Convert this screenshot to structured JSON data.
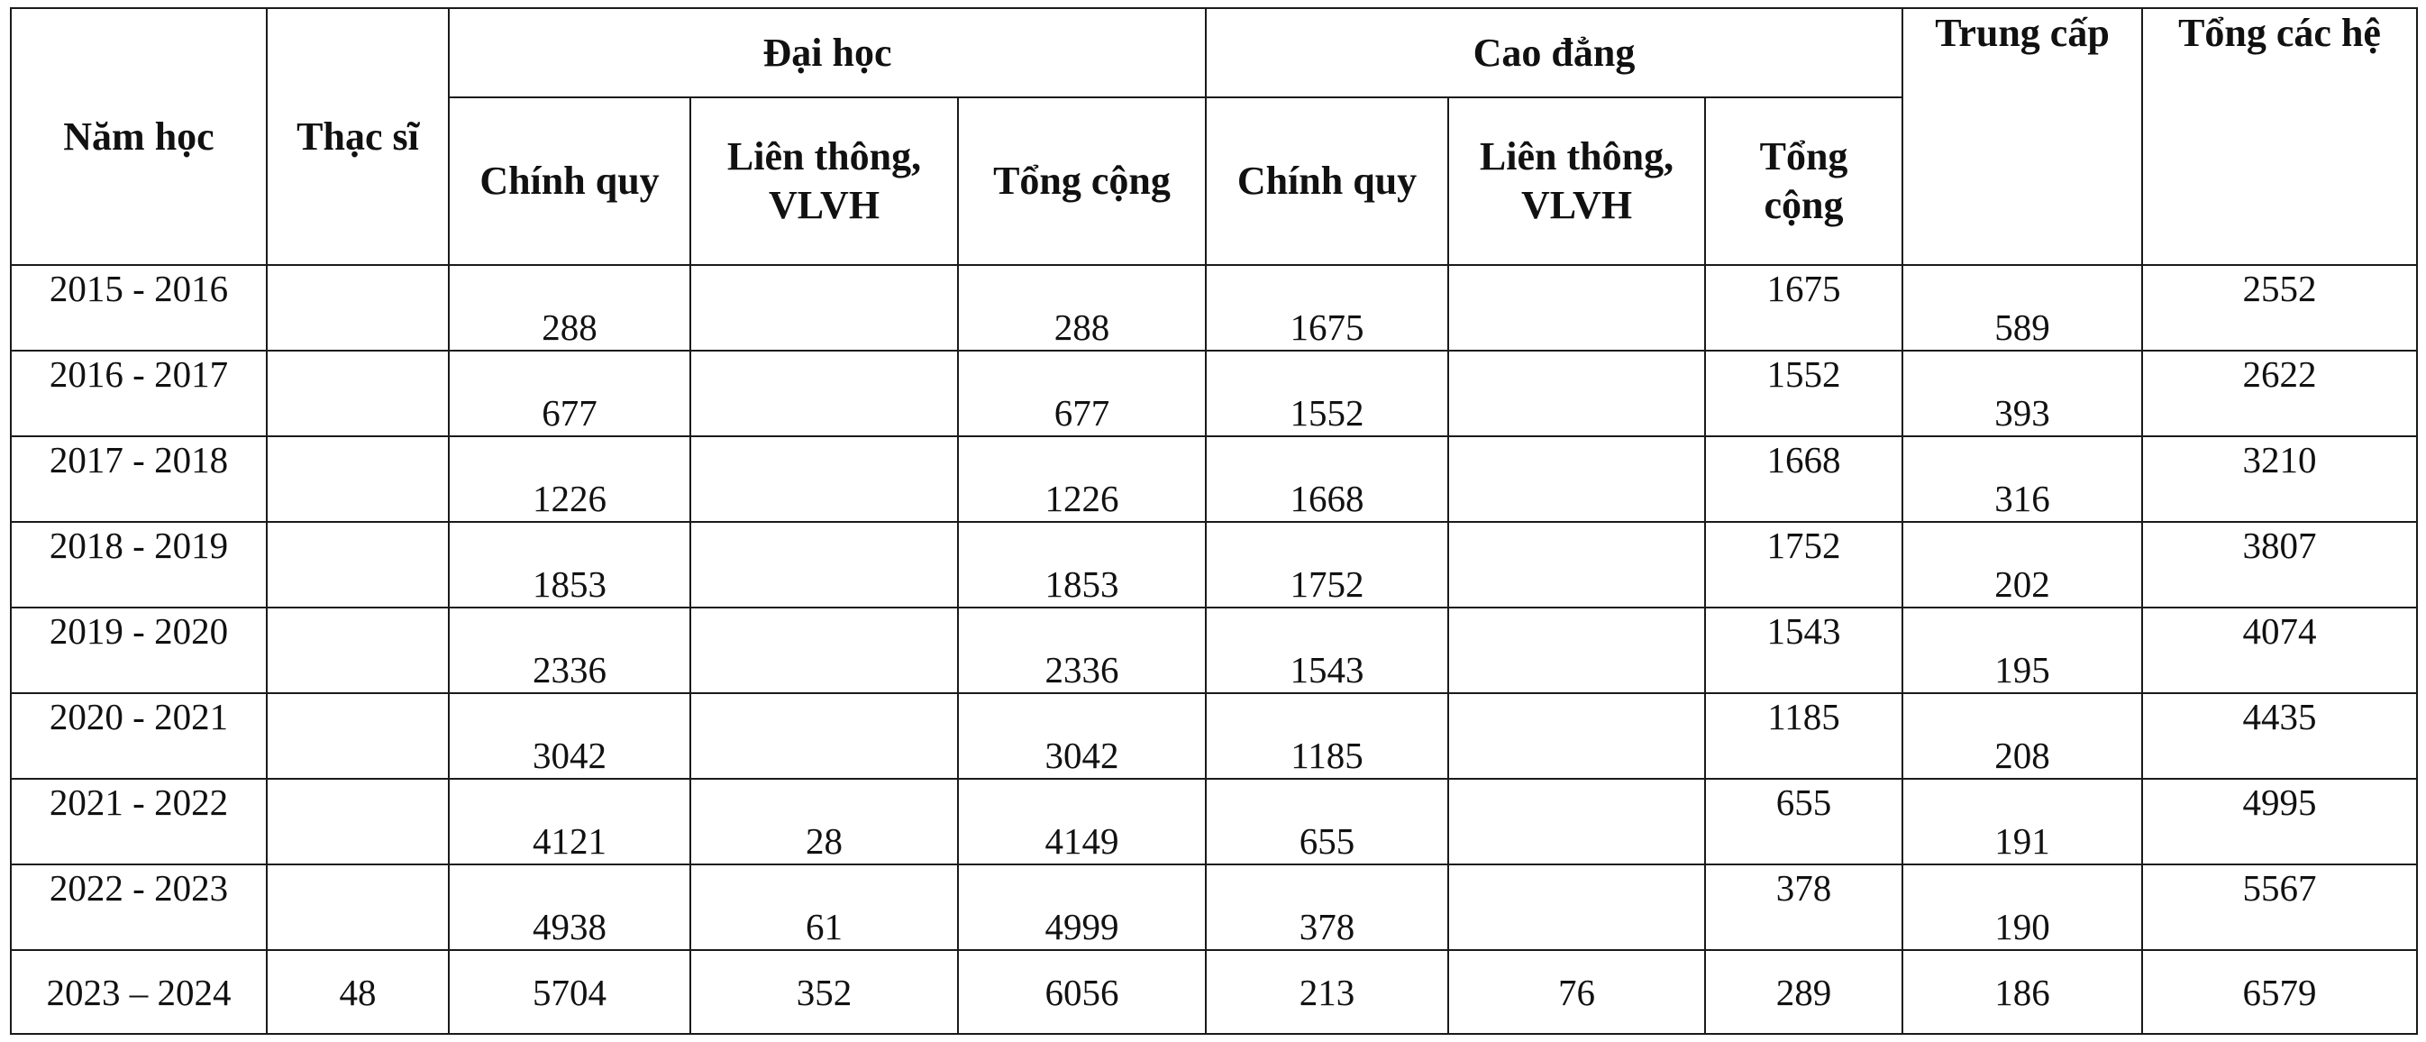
{
  "headers": {
    "nam_hoc": "Năm học",
    "thac_si": "Thạc sĩ",
    "dai_hoc": "Đại học",
    "cao_dang": "Cao đẳng",
    "trung_cap": "Trung cấp",
    "tong_cac_he": "Tổng các hệ",
    "dh_chinh_quy": "Chính quy",
    "dh_lien_thong_1": "Liên thông,",
    "dh_lien_thong_2": "VLVH",
    "dh_tong_cong": "Tổng cộng",
    "cd_chinh_quy": "Chính quy",
    "cd_lien_thong_1": "Liên thông,",
    "cd_lien_thong_2": "VLVH",
    "cd_tong_cong_1": "Tổng",
    "cd_tong_cong_2": "cộng"
  },
  "rows": [
    {
      "nam_hoc": "2015 - 2016",
      "thac_si": "",
      "dh_chinh_quy": "288",
      "dh_lien_thong": "",
      "dh_tong_cong": "288",
      "cd_chinh_quy": "1675",
      "cd_lien_thong": "",
      "cd_tong_cong": "1675",
      "trung_cap": "589",
      "tong_cac_he": "2552"
    },
    {
      "nam_hoc": "2016 - 2017",
      "thac_si": "",
      "dh_chinh_quy": "677",
      "dh_lien_thong": "",
      "dh_tong_cong": "677",
      "cd_chinh_quy": "1552",
      "cd_lien_thong": "",
      "cd_tong_cong": "1552",
      "trung_cap": "393",
      "tong_cac_he": "2622"
    },
    {
      "nam_hoc": "2017 - 2018",
      "thac_si": "",
      "dh_chinh_quy": "1226",
      "dh_lien_thong": "",
      "dh_tong_cong": "1226",
      "cd_chinh_quy": "1668",
      "cd_lien_thong": "",
      "cd_tong_cong": "1668",
      "trung_cap": "316",
      "tong_cac_he": "3210"
    },
    {
      "nam_hoc": "2018 - 2019",
      "thac_si": "",
      "dh_chinh_quy": "1853",
      "dh_lien_thong": "",
      "dh_tong_cong": "1853",
      "cd_chinh_quy": "1752",
      "cd_lien_thong": "",
      "cd_tong_cong": "1752",
      "trung_cap": "202",
      "tong_cac_he": "3807"
    },
    {
      "nam_hoc": "2019 - 2020",
      "thac_si": "",
      "dh_chinh_quy": "2336",
      "dh_lien_thong": "",
      "dh_tong_cong": "2336",
      "cd_chinh_quy": "1543",
      "cd_lien_thong": "",
      "cd_tong_cong": "1543",
      "trung_cap": "195",
      "tong_cac_he": "4074"
    },
    {
      "nam_hoc": "2020 - 2021",
      "thac_si": "",
      "dh_chinh_quy": "3042",
      "dh_lien_thong": "",
      "dh_tong_cong": "3042",
      "cd_chinh_quy": "1185",
      "cd_lien_thong": "",
      "cd_tong_cong": "1185",
      "trung_cap": "208",
      "tong_cac_he": "4435"
    },
    {
      "nam_hoc": "2021 - 2022",
      "thac_si": "",
      "dh_chinh_quy": "4121",
      "dh_lien_thong": "28",
      "dh_tong_cong": "4149",
      "cd_chinh_quy": "655",
      "cd_lien_thong": "",
      "cd_tong_cong": "655",
      "trung_cap": "191",
      "tong_cac_he": "4995"
    },
    {
      "nam_hoc": "2022 - 2023",
      "thac_si": "",
      "dh_chinh_quy": "4938",
      "dh_lien_thong": "61",
      "dh_tong_cong": "4999",
      "cd_chinh_quy": "378",
      "cd_lien_thong": "",
      "cd_tong_cong": "378",
      "trung_cap": "190",
      "tong_cac_he": "5567"
    },
    {
      "nam_hoc": "2023 – 2024",
      "thac_si": "48",
      "dh_chinh_quy": "5704",
      "dh_lien_thong": "352",
      "dh_tong_cong": "6056",
      "cd_chinh_quy": "213",
      "cd_lien_thong": "76",
      "cd_tong_cong": "289",
      "trung_cap": "186",
      "tong_cac_he": "6579"
    }
  ]
}
